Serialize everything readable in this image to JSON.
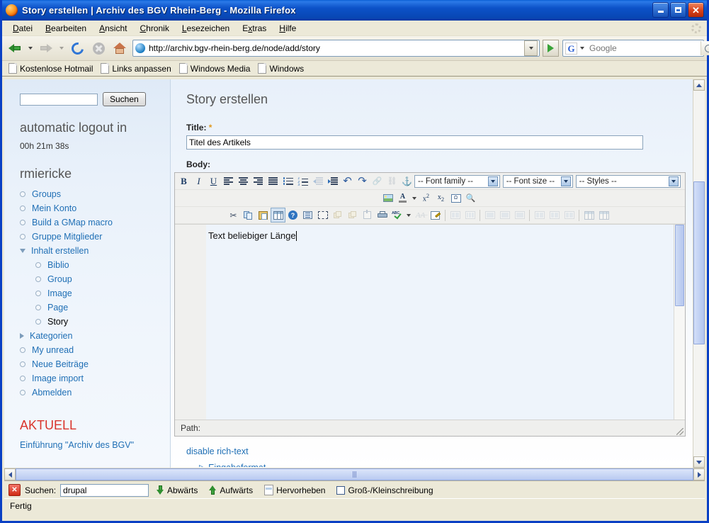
{
  "window": {
    "title": "Story erstellen | Archiv des BGV Rhein-Berg - Mozilla Firefox",
    "app_icon": "firefox-icon",
    "minimize_label": "Minimieren",
    "maximize_label": "Maximieren",
    "close_label": "Schließen"
  },
  "menubar": {
    "items": [
      {
        "label": "Datei"
      },
      {
        "label": "Bearbeiten"
      },
      {
        "label": "Ansicht"
      },
      {
        "label": "Chronik"
      },
      {
        "label": "Lesezeichen"
      },
      {
        "label": "Extras"
      },
      {
        "label": "Hilfe"
      }
    ]
  },
  "navbar": {
    "back": "back-icon",
    "forward": "forward-icon",
    "reload": "reload-icon",
    "stop": "stop-icon",
    "home": "home-icon",
    "url": "http://archiv.bgv-rhein-berg.de/node/add/story",
    "site_icon": "drupal-favicon",
    "go_label": "Gehe zu",
    "search_engine": "G",
    "search_placeholder": "Google",
    "search_value": ""
  },
  "bookmarks": {
    "items": [
      {
        "label": "Kostenlose Hotmail"
      },
      {
        "label": "Links anpassen"
      },
      {
        "label": "Windows Media"
      },
      {
        "label": "Windows"
      }
    ]
  },
  "sidebar": {
    "search_value": "",
    "search_button": "Suchen",
    "logout_heading": "automatic logout in",
    "logout_timer": "00h 21m 38s",
    "username": "rmiericke",
    "menu": [
      {
        "label": "Groups",
        "level": 1,
        "marker": "bullet",
        "state": "link"
      },
      {
        "label": "Mein Konto",
        "level": 1,
        "marker": "bullet",
        "state": "link"
      },
      {
        "label": "Build a GMap macro",
        "level": 1,
        "marker": "bullet",
        "state": "link"
      },
      {
        "label": "Gruppe Mitglieder",
        "level": 1,
        "marker": "bullet",
        "state": "link"
      },
      {
        "label": "Inhalt erstellen",
        "level": 1,
        "marker": "triangle-down",
        "state": "link"
      },
      {
        "label": "Biblio",
        "level": 2,
        "marker": "bullet",
        "state": "link"
      },
      {
        "label": "Group",
        "level": 2,
        "marker": "bullet",
        "state": "link"
      },
      {
        "label": "Image",
        "level": 2,
        "marker": "bullet",
        "state": "link"
      },
      {
        "label": "Page",
        "level": 2,
        "marker": "bullet",
        "state": "link"
      },
      {
        "label": "Story",
        "level": 2,
        "marker": "bullet",
        "state": "current"
      },
      {
        "label": "Kategorien",
        "level": 1,
        "marker": "triangle-right",
        "state": "link"
      },
      {
        "label": "My unread",
        "level": 1,
        "marker": "bullet",
        "state": "link"
      },
      {
        "label": "Neue Beiträge",
        "level": 1,
        "marker": "bullet",
        "state": "link"
      },
      {
        "label": "Image import",
        "level": 1,
        "marker": "bullet",
        "state": "link"
      },
      {
        "label": "Abmelden",
        "level": 1,
        "marker": "bullet",
        "state": "link"
      }
    ],
    "aktuell_heading": "AKTUELL",
    "aktuell_link": "Einführung \"Archiv des BGV\"",
    "heading_color": "#d9342b",
    "link_color": "#1f6fb5"
  },
  "main": {
    "page_title": "Story erstellen",
    "title_field": {
      "label": "Title:",
      "required_mark": "*",
      "value": "Titel des Artikels",
      "placeholder": ""
    },
    "body_field": {
      "label": "Body:",
      "content": "Text beliebiger Länge"
    },
    "editor": {
      "font_family": "-- Font family --",
      "font_size": "-- Font size --",
      "styles": "-- Styles --",
      "path_label": "Path:",
      "toolbar_row1": [
        {
          "name": "bold-icon",
          "label": "B",
          "state": "enabled"
        },
        {
          "name": "italic-icon",
          "label": "I",
          "state": "enabled"
        },
        {
          "name": "underline-icon",
          "label": "U",
          "state": "enabled"
        },
        {
          "name": "align-left-icon",
          "label": "",
          "state": "enabled"
        },
        {
          "name": "align-center-icon",
          "label": "",
          "state": "enabled"
        },
        {
          "name": "align-right-icon",
          "label": "",
          "state": "enabled"
        },
        {
          "name": "align-justify-icon",
          "label": "",
          "state": "enabled"
        },
        {
          "name": "bullet-list-icon",
          "label": "",
          "state": "enabled"
        },
        {
          "name": "numbered-list-icon",
          "label": "",
          "state": "enabled"
        },
        {
          "name": "outdent-icon",
          "label": "",
          "state": "disabled"
        },
        {
          "name": "indent-icon",
          "label": "",
          "state": "enabled"
        },
        {
          "name": "undo-icon",
          "label": "",
          "state": "enabled"
        },
        {
          "name": "redo-icon",
          "label": "",
          "state": "enabled"
        },
        {
          "name": "link-icon",
          "label": "",
          "state": "disabled"
        },
        {
          "name": "unlink-icon",
          "label": "",
          "state": "disabled"
        },
        {
          "name": "anchor-icon",
          "label": "",
          "state": "enabled"
        }
      ],
      "toolbar_row2": [
        {
          "name": "insert-image-icon",
          "state": "enabled"
        },
        {
          "name": "text-color-icon",
          "state": "enabled"
        },
        {
          "name": "superscript-icon",
          "state": "enabled"
        },
        {
          "name": "subscript-icon",
          "state": "enabled"
        },
        {
          "name": "special-character-icon",
          "state": "enabled"
        },
        {
          "name": "search-replace-icon",
          "state": "enabled"
        }
      ],
      "toolbar_row3": [
        {
          "name": "cut-icon",
          "state": "enabled"
        },
        {
          "name": "copy-icon",
          "state": "enabled"
        },
        {
          "name": "paste-icon",
          "state": "enabled"
        },
        {
          "name": "insert-table-icon",
          "state": "selected"
        },
        {
          "name": "help-icon",
          "state": "enabled"
        },
        {
          "name": "block-quote-icon",
          "state": "enabled"
        },
        {
          "name": "visual-aid-icon",
          "state": "enabled"
        },
        {
          "name": "layer-forward-icon",
          "state": "disabled"
        },
        {
          "name": "layer-backward-icon",
          "state": "disabled"
        },
        {
          "name": "insert-layer-icon",
          "state": "disabled"
        },
        {
          "name": "print-icon",
          "state": "enabled"
        },
        {
          "name": "spellcheck-icon",
          "state": "enabled"
        },
        {
          "name": "remove-formatting-icon",
          "state": "disabled"
        },
        {
          "name": "edit-html-icon",
          "state": "enabled"
        },
        {
          "name": "merge-cells-icon",
          "state": "disabled"
        },
        {
          "name": "split-cells-icon",
          "state": "disabled"
        },
        {
          "name": "insert-row-before-icon",
          "state": "disabled"
        },
        {
          "name": "insert-row-after-icon",
          "state": "disabled"
        },
        {
          "name": "delete-row-icon",
          "state": "disabled"
        },
        {
          "name": "insert-column-before-icon",
          "state": "disabled"
        },
        {
          "name": "insert-column-after-icon",
          "state": "disabled"
        },
        {
          "name": "delete-column-icon",
          "state": "disabled"
        },
        {
          "name": "table-row-props-icon",
          "state": "disabled"
        },
        {
          "name": "table-cell-props-icon",
          "state": "disabled"
        }
      ]
    },
    "disable_richtext_link": "disable rich-text"
  },
  "findbar": {
    "label": "Suchen:",
    "value": "drupal",
    "placeholder": "",
    "next_label": "Abwärts",
    "prev_label": "Aufwärts",
    "highlight_label": "Hervorheben",
    "matchcase_label": "Groß-/Kleinschreibung",
    "matchcase_checked": false
  },
  "statusbar": {
    "text": "Fertig"
  }
}
